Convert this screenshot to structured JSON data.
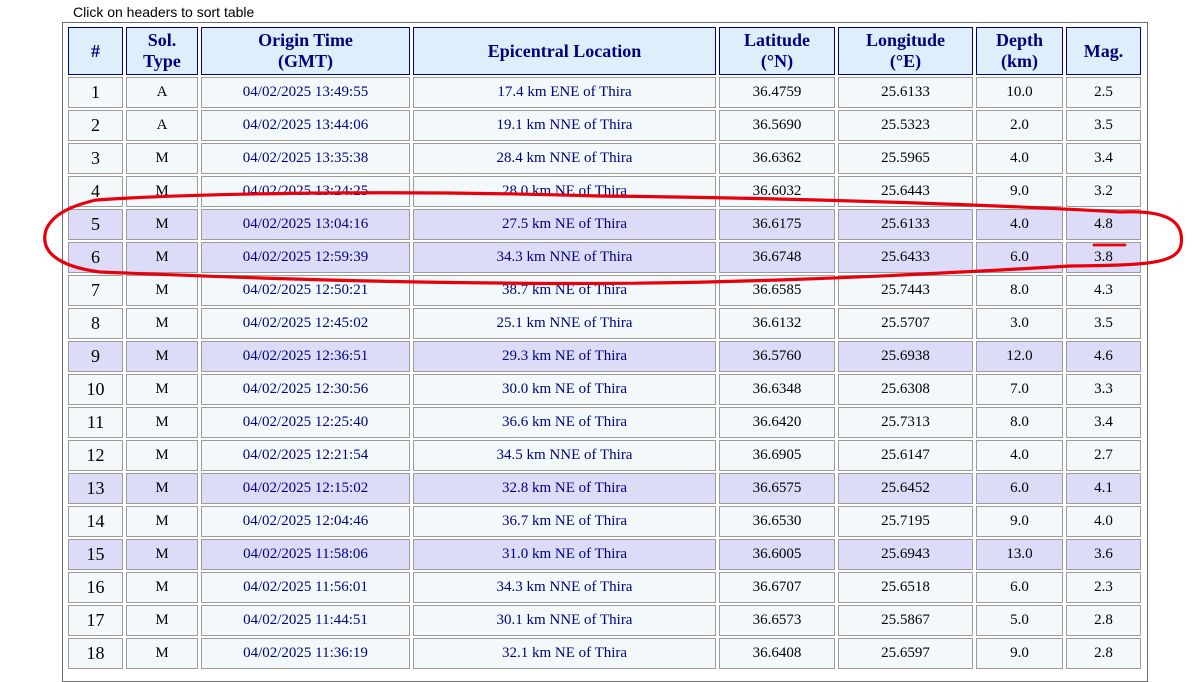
{
  "hint": "Click on headers to sort table",
  "headers": [
    "#",
    "Sol. Type",
    "Origin Time (GMT)",
    "Epicentral Location",
    "Latitude (°N)",
    "Longitude (°E)",
    "Depth (km)",
    "Mag."
  ],
  "header_lines": [
    [
      "#"
    ],
    [
      "Sol.",
      "Type"
    ],
    [
      "Origin Time",
      "(GMT)"
    ],
    [
      "Epicentral Location"
    ],
    [
      "Latitude",
      "(°N)"
    ],
    [
      "Longitude",
      "(°E)"
    ],
    [
      "Depth",
      "(km)"
    ],
    [
      "Mag."
    ]
  ],
  "rows": [
    [
      "1",
      "A",
      "04/02/2025 13:49:55",
      "17.4 km ENE of Thira",
      "36.4759",
      "25.6133",
      "10.0",
      "2.5"
    ],
    [
      "2",
      "A",
      "04/02/2025 13:44:06",
      "19.1 km NNE of Thira",
      "36.5690",
      "25.5323",
      "2.0",
      "3.5"
    ],
    [
      "3",
      "M",
      "04/02/2025 13:35:38",
      "28.4 km NNE of Thira",
      "36.6362",
      "25.5965",
      "4.0",
      "3.4"
    ],
    [
      "4",
      "M",
      "04/02/2025 13:24:25",
      "28.0 km NE of Thira",
      "36.6032",
      "25.6443",
      "9.0",
      "3.2"
    ],
    [
      "5",
      "M",
      "04/02/2025 13:04:16",
      "27.5 km NE of Thira",
      "36.6175",
      "25.6133",
      "4.0",
      "4.8"
    ],
    [
      "6",
      "M",
      "04/02/2025 12:59:39",
      "34.3 km NNE of Thira",
      "36.6748",
      "25.6433",
      "6.0",
      "3.8"
    ],
    [
      "7",
      "M",
      "04/02/2025 12:50:21",
      "38.7 km NE of Thira",
      "36.6585",
      "25.7443",
      "8.0",
      "4.3"
    ],
    [
      "8",
      "M",
      "04/02/2025 12:45:02",
      "25.1 km NNE of Thira",
      "36.6132",
      "25.5707",
      "3.0",
      "3.5"
    ],
    [
      "9",
      "M",
      "04/02/2025 12:36:51",
      "29.3 km NE of Thira",
      "36.5760",
      "25.6938",
      "12.0",
      "4.6"
    ],
    [
      "10",
      "M",
      "04/02/2025 12:30:56",
      "30.0 km NE of Thira",
      "36.6348",
      "25.6308",
      "7.0",
      "3.3"
    ],
    [
      "11",
      "M",
      "04/02/2025 12:25:40",
      "36.6 km NE of Thira",
      "36.6420",
      "25.7313",
      "8.0",
      "3.4"
    ],
    [
      "12",
      "M",
      "04/02/2025 12:21:54",
      "34.5 km NNE of Thira",
      "36.6905",
      "25.6147",
      "4.0",
      "2.7"
    ],
    [
      "13",
      "M",
      "04/02/2025 12:15:02",
      "32.8 km NE of Thira",
      "36.6575",
      "25.6452",
      "6.0",
      "4.1"
    ],
    [
      "14",
      "M",
      "04/02/2025 12:04:46",
      "36.7 km NE of Thira",
      "36.6530",
      "25.7195",
      "9.0",
      "4.0"
    ],
    [
      "15",
      "M",
      "04/02/2025 11:58:06",
      "31.0 km NE of Thira",
      "36.6005",
      "25.6943",
      "13.0",
      "3.6"
    ],
    [
      "16",
      "M",
      "04/02/2025 11:56:01",
      "34.3 km NNE of Thira",
      "36.6707",
      "25.6518",
      "6.0",
      "2.3"
    ],
    [
      "17",
      "M",
      "04/02/2025 11:44:51",
      "30.1 km NNE of Thira",
      "36.6573",
      "25.5867",
      "5.0",
      "2.8"
    ],
    [
      "18",
      "M",
      "04/02/2025 11:36:19",
      "32.1 km NE of Thira",
      "36.6408",
      "25.6597",
      "9.0",
      "2.8"
    ]
  ],
  "row_shading": [
    "odd",
    "odd",
    "odd",
    "odd",
    "even",
    "even",
    "odd",
    "odd",
    "even",
    "odd",
    "odd",
    "odd",
    "even",
    "odd",
    "even",
    "odd",
    "odd",
    "odd"
  ],
  "annotation": {
    "color": "#e8000b",
    "highlighted_rows": [
      "5",
      "6"
    ],
    "underlined_value": "4.8"
  }
}
